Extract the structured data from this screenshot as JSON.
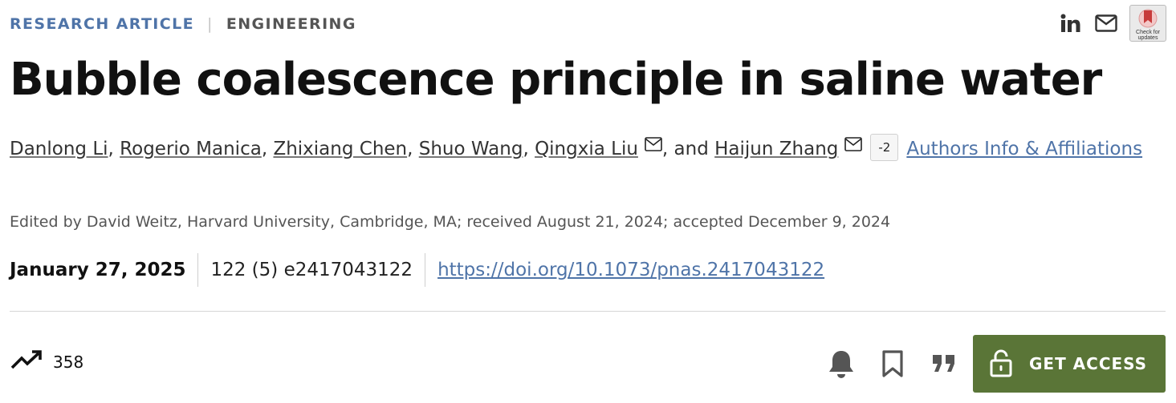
{
  "header": {
    "category_primary": "RESEARCH ARTICLE",
    "separator": "|",
    "category_secondary": "ENGINEERING",
    "share_icons": [
      "linkedin-icon",
      "mail-icon"
    ],
    "badge_text": "Check for updates"
  },
  "article": {
    "title": "Bubble coalescence principle in saline water",
    "authors": [
      "Danlong Li",
      "Rogerio Manica",
      "Zhixiang Chen",
      "Shuo Wang",
      "Qingxia Liu",
      "Haijun Zhang"
    ],
    "comma": ",",
    "and_text": ", and",
    "more_count": "-2",
    "authors_info_link": "Authors Info & Affiliations",
    "edited_by": "Edited by David Weitz, Harvard University, Cambridge, MA; received August 21, 2024; accepted December 9, 2024",
    "pub_date": "January 27, 2025",
    "volume_info": "122 (5) e2417043122",
    "doi": "https://doi.org/10.1073/pnas.2417043122"
  },
  "metrics": {
    "icon": "trending-up-icon",
    "value": "358"
  },
  "actions": {
    "icons": [
      "bell-icon",
      "bookmark-icon",
      "quote-icon"
    ],
    "get_access_label": "GET ACCESS"
  },
  "colors": {
    "accent_blue": "#4f74a8",
    "access_green": "#5a7537"
  }
}
